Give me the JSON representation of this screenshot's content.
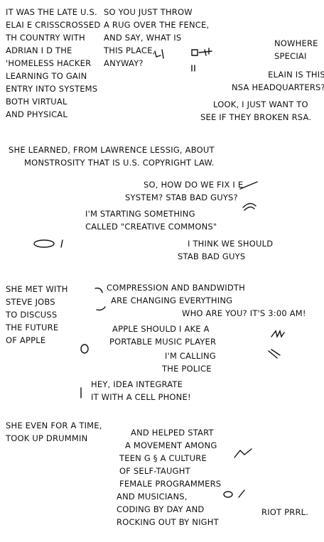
{
  "comic": {
    "panel1": {
      "narration": [
        "IT WAS THE LATE  U.S.",
        "ELAI  E CRISSCROSSED",
        "TH  COUNTRY WITH",
        "ADRIAN  I  D THE",
        "'HOMELESS HACKER",
        "LEARNING TO GAIN",
        "ENTRY INTO SYSTEMS",
        "BOTH VIRTUAL",
        "AND PHYSICAL"
      ],
      "speech_fence": [
        "SO YOU JUST THROW",
        "A RUG OVER THE FENCE,",
        "AND   SAY, WHAT IS",
        "THIS PLACE,",
        "ANYWAY?"
      ],
      "speech_nowhere": [
        "NOWHERE",
        "SPECIAI"
      ],
      "speech_nsa": [
        "ELAIN   IS THIS",
        "NSA HEADQUARTERS?"
      ],
      "speech_look": [
        "LOOK, I JUST WANT TO",
        "SEE IF THEY   BROKEN RSA."
      ]
    },
    "panel2": {
      "narration": [
        "SHE LEARNED,  FROM LAWRENCE LESSIG, ABOUT",
        "MONSTROSITY THAT IS U.S. COPYRIGHT LAW."
      ],
      "speech_fix": [
        "SO,  HOW DO WE FIX  I E",
        "SYSTEM?  STAB BAD GUYS?"
      ],
      "speech_cc": [
        "I'M STARTING SOMETHING",
        "CALLED \"CREATIVE COMMONS\""
      ],
      "speech_stab": [
        "I THINK WE SHOULD",
        "STAB BAD GUYS"
      ]
    },
    "panel3": {
      "narration": [
        "SHE MET WITH",
        "STEVE JOBS",
        "TO DISCUSS",
        "THE FUTURE",
        "OF APPLE"
      ],
      "speech_compression": [
        "COMPRESSION AND BANDWIDTH",
        "ARE CHANGING EVERYTHING"
      ],
      "speech_who": [
        "WHO ARE YOU?  IT'S 3:00 AM!"
      ],
      "speech_apple": [
        "APPLE SHOULD  I  AKE A",
        "PORTABLE MUSIC PLAYER"
      ],
      "speech_police": [
        "I'M CALLING",
        "THE POLICE"
      ],
      "speech_phone": [
        "HEY, IDEA   INTEGRATE",
        "IT WITH A CELL PHONE!"
      ]
    },
    "panel4": {
      "narration": [
        "SHE EVEN  FOR A TIME,",
        "TOOK UP DRUMMIN"
      ],
      "speech_movement": [
        "AND HELPED START",
        "A MOVEMENT AMONG",
        "TEEN G   §  A CULTURE",
        "OF SELF-TAUGHT",
        "FEMALE PROGRAMMERS",
        "AND MUSICIANS,",
        "CODING BY DAY AND",
        "ROCKING OUT BY NIGHT"
      ],
      "speech_riot": [
        "RIOT PRRL."
      ]
    }
  }
}
